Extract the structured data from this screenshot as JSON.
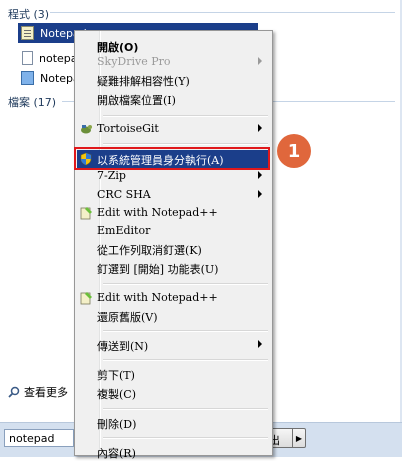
{
  "start_menu": {
    "programs_header": "程式 (3)",
    "files_header": "檔案 (17)",
    "results": [
      {
        "label": "Notepad++"
      },
      {
        "label": "notepad"
      },
      {
        "label": "Notepad"
      }
    ],
    "see_more": "查看更多",
    "search_value": "notepad",
    "shutdown_label": "出"
  },
  "context_menu": {
    "items": [
      {
        "label": "開啟(O)"
      },
      {
        "label": "SkyDrive Pro"
      },
      {
        "label": "疑難排解相容性(Y)"
      },
      {
        "label": "開啟檔案位置(I)"
      },
      {
        "label": "TortoiseGit"
      },
      {
        "label": "以系統管理員身分執行(A)"
      },
      {
        "label": "7-Zip"
      },
      {
        "label": "CRC SHA"
      },
      {
        "label": "Edit with Notepad++"
      },
      {
        "label": "EmEditor"
      },
      {
        "label": "從工作列取消釘選(K)"
      },
      {
        "label": "釘選到 [開始] 功能表(U)"
      },
      {
        "label": "Edit with Notepad++"
      },
      {
        "label": "還原舊版(V)"
      },
      {
        "label": "傳送到(N)"
      },
      {
        "label": "剪下(T)"
      },
      {
        "label": "複製(C)"
      },
      {
        "label": "刪除(D)"
      },
      {
        "label": "內容(R)"
      }
    ]
  },
  "annotation": {
    "step_number": "1",
    "color": "#e0673c",
    "highlight_color": "#e0181b"
  }
}
